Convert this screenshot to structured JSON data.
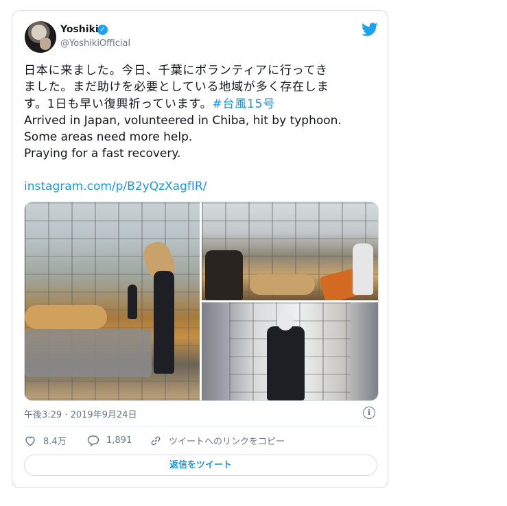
{
  "tweet": {
    "author_name": "Yoshiki",
    "author_handle": "@YoshikiOfficial",
    "text_lines": [
      "日本に来ました。今日、千葉にボランティアに行ってき",
      "ました。まだ助けを必要としている地域が多く存在しま",
      "す。1日も早い復興祈っています。",
      "Arrived in Japan, volunteered in Chiba, hit by typhoon.",
      "Some areas need more help.",
      "Praying for a fast recovery."
    ],
    "hashtag": "#台風15号",
    "link": "instagram.com/p/B2yQzXagfIR/",
    "timestamp": "午後3:29 · 2019年9月24日",
    "likes": "8.4万",
    "replies": "1,891",
    "copy_link": "ツイートへのリンクをコピー",
    "reply_button": "返信をツイート"
  },
  "colors": {
    "accent": "#1b95e0",
    "muted": "#657786",
    "border": "#d6dde3",
    "verified": "#1da1f2"
  },
  "icons": [
    "verified-badge-icon",
    "twitter-bird-icon",
    "info-icon",
    "heart-icon",
    "reply-icon",
    "link-icon"
  ]
}
